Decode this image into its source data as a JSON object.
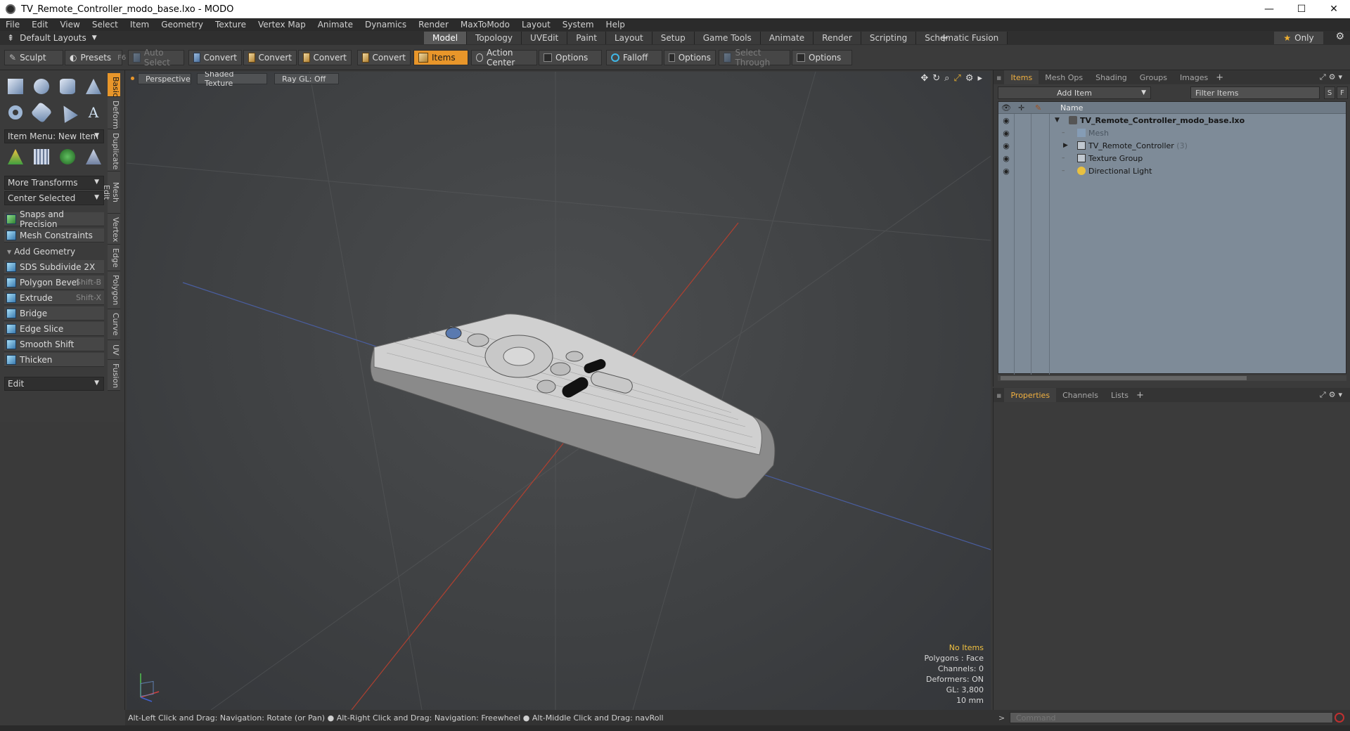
{
  "window": {
    "title": "TV_Remote_Controller_modo_base.lxo - MODO",
    "minimize": "—",
    "maximize": "☐",
    "close": "✕"
  },
  "menu": [
    "File",
    "Edit",
    "View",
    "Select",
    "Item",
    "Geometry",
    "Texture",
    "Vertex Map",
    "Animate",
    "Dynamics",
    "Render",
    "MaxToModo",
    "Layout",
    "System",
    "Help"
  ],
  "layouts": {
    "dropdown": "Default Layouts",
    "tabs": [
      "Model",
      "Topology",
      "UVEdit",
      "Paint",
      "Layout",
      "Setup",
      "Game Tools",
      "Animate",
      "Render",
      "Scripting",
      "Schematic Fusion"
    ],
    "active_tab": "Model",
    "only_label": "Only"
  },
  "toolbar": {
    "sculpt": "Sculpt",
    "presets": "Presets",
    "presets_key": "F6",
    "auto_select": "Auto Select",
    "convert1": "Convert",
    "convert2": "Convert",
    "convert3": "Convert",
    "convert4": "Convert",
    "items": "Items",
    "action_center": "Action Center",
    "options1": "Options",
    "falloff": "Falloff",
    "options2": "Options",
    "select_through": "Select Through",
    "options3": "Options"
  },
  "left_panel": {
    "item_menu": "Item Menu: New Item",
    "more_transforms": "More Transforms",
    "center_selected": "Center Selected",
    "snaps": "Snaps and Precision",
    "mesh_constraints": "Mesh Constraints",
    "add_geometry": "Add Geometry",
    "tools": [
      {
        "label": "SDS Subdivide 2X",
        "key": ""
      },
      {
        "label": "Polygon Bevel",
        "key": "Shift-B"
      },
      {
        "label": "Extrude",
        "key": "Shift-X"
      },
      {
        "label": "Bridge",
        "key": ""
      },
      {
        "label": "Edge Slice",
        "key": ""
      },
      {
        "label": "Smooth Shift",
        "key": ""
      },
      {
        "label": "Thicken",
        "key": ""
      }
    ],
    "edit_dd": "Edit",
    "side_tabs": [
      "Basic",
      "Deform",
      "Duplicate",
      "Mesh Edit",
      "Vertex",
      "Edge",
      "Polygon",
      "Curve",
      "UV",
      "Fusion"
    ]
  },
  "viewport": {
    "view": "Perspective",
    "shading": "Shaded Texture",
    "raygl": "Ray GL: Off",
    "stats": {
      "no_items": "No Items",
      "polygons": "Polygons : Face",
      "channels": "Channels: 0",
      "deformers": "Deformers: ON",
      "gl": "GL: 3,800",
      "scale": "10 mm"
    }
  },
  "status": "Alt-Left Click and Drag: Navigation: Rotate (or Pan) ● Alt-Right Click and Drag: Navigation: Freewheel ● Alt-Middle Click and Drag: navRoll",
  "items_panel": {
    "tabs": [
      "Items",
      "Mesh Ops",
      "Shading",
      "Groups",
      "Images"
    ],
    "active": "Items",
    "add_item": "Add Item",
    "filter": "Filter Items",
    "s_btn": "S",
    "f_btn": "F",
    "col_name": "Name",
    "rows": [
      {
        "label": "TV_Remote_Controller_modo_base.lxo",
        "count": ""
      },
      {
        "label": "Mesh",
        "count": ""
      },
      {
        "label": "TV_Remote_Controller",
        "count": "(3)"
      },
      {
        "label": "Texture Group",
        "count": ""
      },
      {
        "label": "Directional Light",
        "count": ""
      }
    ]
  },
  "props_panel": {
    "tabs": [
      "Properties",
      "Channels",
      "Lists"
    ],
    "active": "Properties"
  },
  "command": {
    "placeholder": "Command"
  },
  "colors": {
    "accent": "#e8962a",
    "tree_bg": "#7e8b98"
  }
}
